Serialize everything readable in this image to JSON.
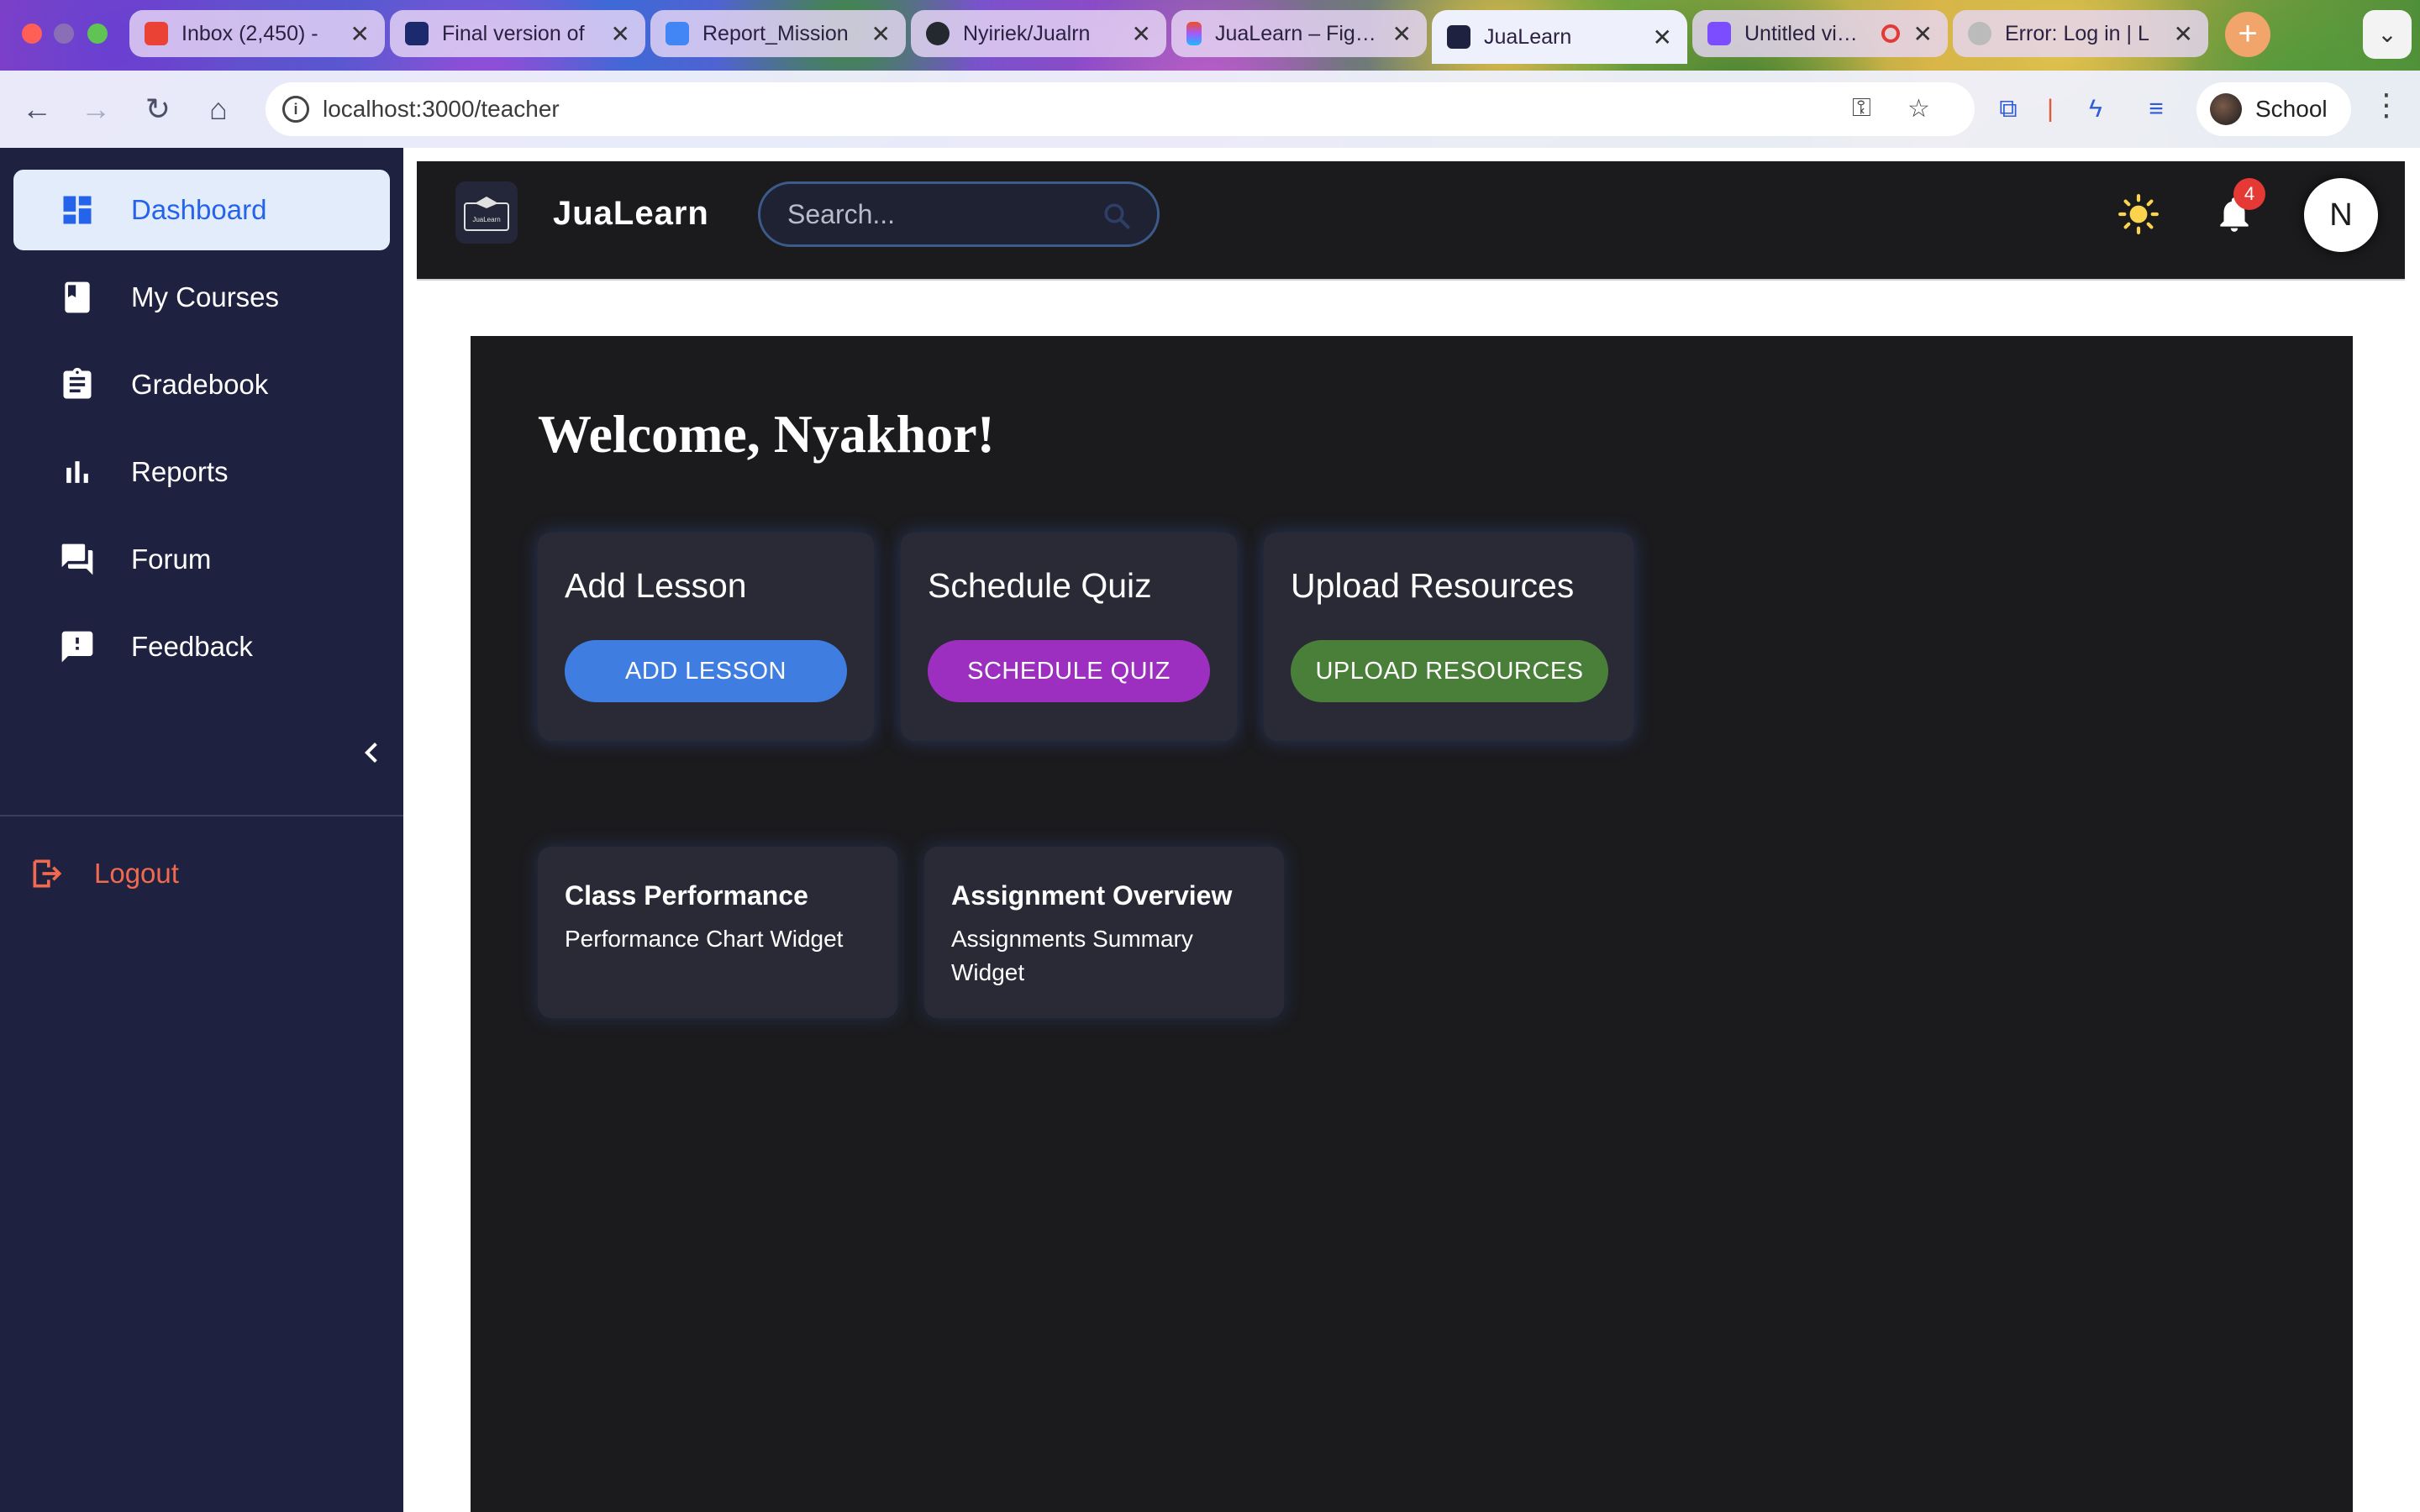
{
  "browser": {
    "tabs": [
      {
        "label": "Inbox (2,450) -",
        "icon": "gmail-icon",
        "color": "#ea4335"
      },
      {
        "label": "Final version of",
        "icon": "document-icon",
        "color": "#1a2a6c"
      },
      {
        "label": "Report_Mission",
        "icon": "google-docs-icon",
        "color": "#4285f4"
      },
      {
        "label": "Nyiriek/Jualrn",
        "icon": "github-icon",
        "color": "#24292f"
      },
      {
        "label": "JuaLearn – Figma",
        "icon": "figma-icon",
        "color": "#f24e1e"
      },
      {
        "label": "JuaLearn",
        "icon": "jualearn-icon",
        "color": "#1f2140",
        "active": true
      },
      {
        "label": "Untitled video",
        "icon": "video-icon",
        "color": "#7c4dff"
      },
      {
        "label": "Error: Log in | L",
        "icon": "globe-icon",
        "color": "#888888"
      }
    ],
    "url": "localhost:3000/teacher",
    "profile_name": "School"
  },
  "sidebar": {
    "items": [
      {
        "label": "Dashboard",
        "icon": "dashboard-icon",
        "active": true
      },
      {
        "label": "My Courses",
        "icon": "book-icon"
      },
      {
        "label": "Gradebook",
        "icon": "clipboard-icon"
      },
      {
        "label": "Reports",
        "icon": "bar-chart-icon"
      },
      {
        "label": "Forum",
        "icon": "forum-icon"
      },
      {
        "label": "Feedback",
        "icon": "feedback-icon"
      }
    ],
    "logout_label": "Logout"
  },
  "header": {
    "brand": "JuaLearn",
    "logo_text": "JuaLearn",
    "search_placeholder": "Search...",
    "notification_count": "4",
    "avatar_initial": "N"
  },
  "main": {
    "welcome": "Welcome, Nyakhor!",
    "actions": [
      {
        "title": "Add Lesson",
        "button": "ADD LESSON",
        "color": "#3f7ee0"
      },
      {
        "title": "Schedule Quiz",
        "button": "SCHEDULE QUIZ",
        "color": "#9c2fbf"
      },
      {
        "title": "Upload Resources",
        "button": "UPLOAD RESOURCES",
        "color": "#4a7f3a"
      }
    ],
    "widgets": [
      {
        "title": "Class Performance",
        "subtitle": "Performance Chart Widget"
      },
      {
        "title": "Assignment Overview",
        "subtitle": "Assignments Summary Widget"
      }
    ]
  },
  "colors": {
    "sidebar_bg": "#1f2140",
    "accent_blue": "#2563eb",
    "logout_red": "#f06a4f",
    "content_bg": "#1b1b1e"
  }
}
